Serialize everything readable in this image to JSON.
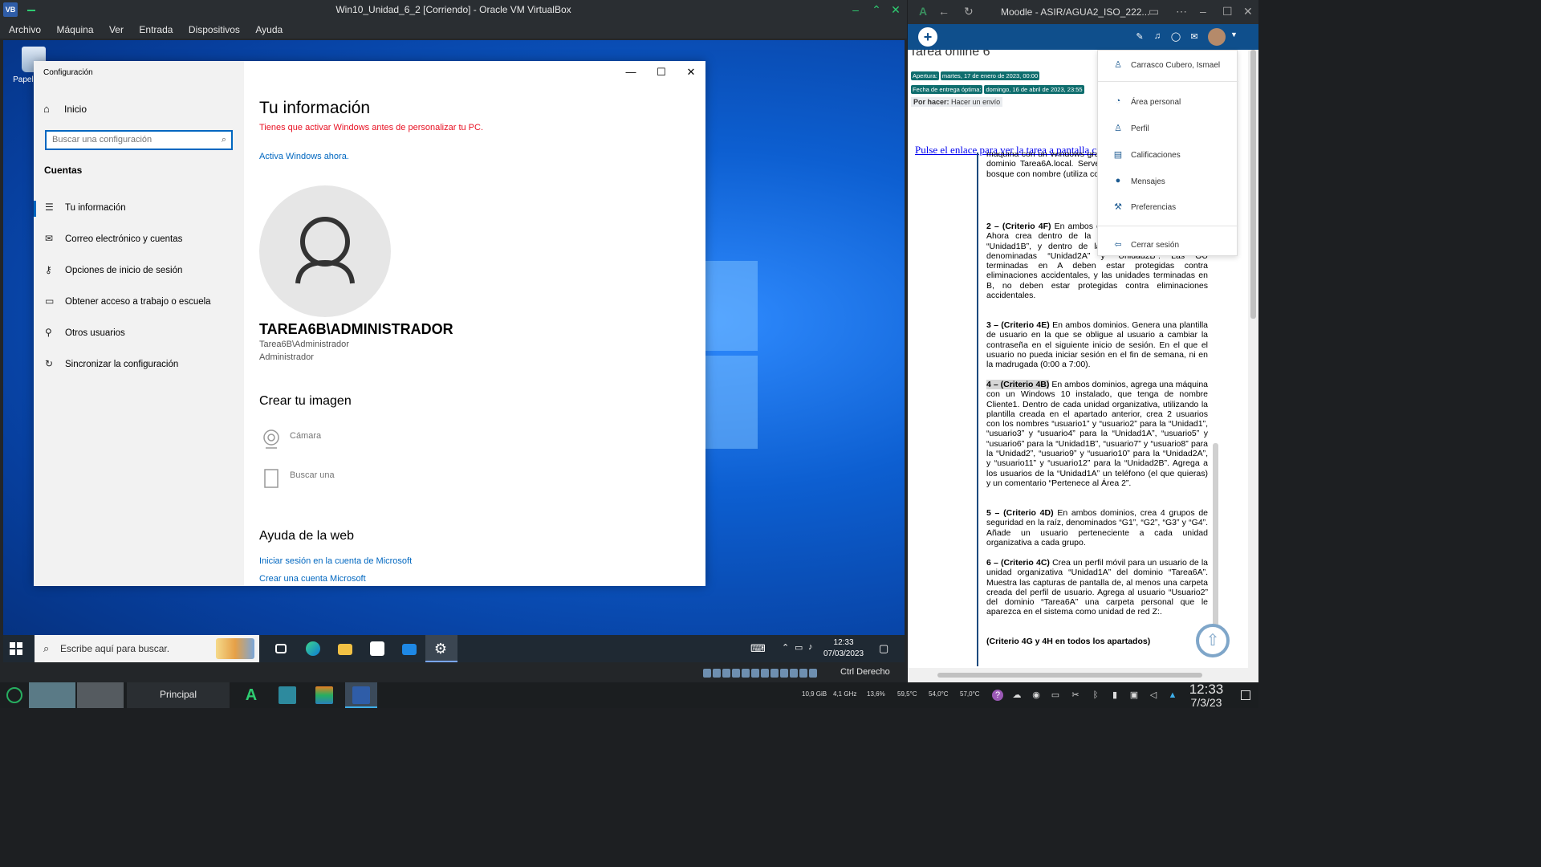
{
  "vbox": {
    "title": "Win10_Unidad_6_2 [Corriendo] - Oracle VM VirtualBox",
    "menu": [
      "Archivo",
      "Máquina",
      "Ver",
      "Entrada",
      "Dispositivos",
      "Ayuda"
    ],
    "host_key": "Ctrl Derecho"
  },
  "desktop": {
    "recycle_bin_label": "Papel recicl"
  },
  "settings": {
    "window_title": "Configuración",
    "home": "Inicio",
    "search_placeholder": "Buscar una configuración",
    "section": "Cuentas",
    "nav": [
      {
        "label": "Tu información",
        "icon": "person-card-icon"
      },
      {
        "label": "Correo electrónico y cuentas",
        "icon": "mail-icon"
      },
      {
        "label": "Opciones de inicio de sesión",
        "icon": "key-icon"
      },
      {
        "label": "Obtener acceso a trabajo o escuela",
        "icon": "briefcase-icon"
      },
      {
        "label": "Otros usuarios",
        "icon": "person-add-icon"
      },
      {
        "label": "Sincronizar la configuración",
        "icon": "sync-icon"
      }
    ],
    "page_title": "Tu información",
    "activation_warning": "Tienes que activar Windows antes de personalizar tu PC.",
    "activate_link": "Activa Windows ahora.",
    "user_display": "TAREA6B\\ADMINISTRADOR",
    "user_account": "Tarea6B\\Administrador",
    "user_role": "Administrador",
    "create_image_heading": "Crear tu imagen",
    "camera_option": "Cámara",
    "browse_option": "Buscar una",
    "web_help_heading": "Ayuda de la web",
    "ms_signin_link": "Iniciar sesión en la cuenta de Microsoft",
    "ms_create_link": "Crear una cuenta Microsoft"
  },
  "guest_taskbar": {
    "search_text": "Escribe aquí para buscar.",
    "time": "12:33",
    "date": "07/03/2023"
  },
  "browser": {
    "title": "Moodle - ASIR/AGUA2_ISO_222...",
    "task_title": "Tarea online 6",
    "opening_label": "Apertura:",
    "opening_value": "martes, 17 de enero de 2023, 00:00",
    "due_label": "Fecha de entrega óptima:",
    "due_value": "domingo, 16 de abril de 2023, 23:55",
    "todo_label": "Por hacer:",
    "todo_value": "Hacer un envío",
    "task_link": "Pulse el enlace para ver la tarea a pantalla c",
    "doc_lines_top": "máquina con un Windows gráfica. Deberás crear un nu de dominio Tarea6A.local. Server Core 2019 en otra nuevo bosque con nombre (utiliza comandos PowerShel",
    "p2_head": "2 – (Criterio 4F)",
    "p2_body": " En ambos d organizativas denominadas Ahora crea dentro de la denominadas “Unidad1A” y “Unidad1B”, y dentro de la OU “Unidad2” otras dos denominadas “Unidad2A” y “Unidad2B”. Las OU terminadas en A deben estar protegidas contra eliminaciones accidentales, y las unidades terminadas en B, no deben estar protegidas contra eliminaciones accidentales.",
    "p3_head": "3 – (Criterio 4E)",
    "p3_body": " En ambos dominios. Genera una plantilla de usuario en la que se obligue al usuario a cambiar la contraseña en el siguiente inicio de sesión. En el que el usuario no pueda iniciar sesión en el fin de semana, ni en la madrugada (0:00 a 7:00).",
    "p4_head": "4 – (Criterio 4B)",
    "p4_body": " En ambos dominios, agrega una máquina con un Windows 10 instalado, que tenga de nombre Cliente1. Dentro de cada unidad organizativa, utilizando la plantilla creada en el apartado anterior, crea 2 usuarios con los nombres “usuario1” y  “usuario2” para la “Unidad1”, “usuario3” y “usuario4” para la “Unidad1A”, “usuario5” y “usuario6” para la “Unidad1B”, “usuario7” y “usuario8” para la “Unidad2”, “usuario9” y “usuario10” para la “Unidad2A”, y “usuario11” y “usuario12” para la “Unidad2B”. Agrega a los usuarios de la “Unidad1A” un teléfono (el que quieras) y un comentario “Pertenece al Área 2”.",
    "p5_head": "5 – (Criterio 4D)",
    "p5_body": " En ambos dominios, crea 4 grupos de seguridad en la raíz, denominados “G1”, “G2”, “G3” y “G4”. Añade un usuario perteneciente a cada unidad organizativa a cada grupo.",
    "p6_head": "6 – (Criterio 4C)",
    "p6_body": " Crea un perfil móvil para un usuario de la unidad organizativa “Unidad1A” del dominio “Tarea6A”. Muestra las capturas de pantalla de, al menos una carpeta creada del perfil de usuario. Agrega al usuario “Usuario2” del dominio “Tarea6A” una carpeta personal que le aparezca en el sistema como unidad de red Z:.",
    "p7_head": "(Criterio 4G y 4H en todos los apartados)",
    "user_menu": [
      {
        "label": "Carrasco Cubero, Ismael",
        "icon": "user-icon"
      },
      {
        "label": "Área personal",
        "icon": "dashboard-icon"
      },
      {
        "label": "Perfil",
        "icon": "profile-icon"
      },
      {
        "label": "Calificaciones",
        "icon": "grades-icon"
      },
      {
        "label": "Mensajes",
        "icon": "messages-icon"
      },
      {
        "label": "Preferencias",
        "icon": "wrench-icon"
      },
      {
        "label": "Cerrar sesión",
        "icon": "logout-icon"
      }
    ]
  },
  "host_panel": {
    "desktop_name": "Principal",
    "mem": "10,9 GiB",
    "cpu_freq": "4,1 GHz",
    "cpu_load": "13,6%",
    "temp1": "59,5°C",
    "temp2": "54,0°C",
    "temp3": "57,0°C",
    "time": "12:33",
    "date": "7/3/23"
  },
  "colors": {
    "accent_windows": "#0067c0",
    "warning_red": "#e81123",
    "moodle_nav": "#0f4f8c",
    "badge_teal": "#0f6e6e"
  }
}
